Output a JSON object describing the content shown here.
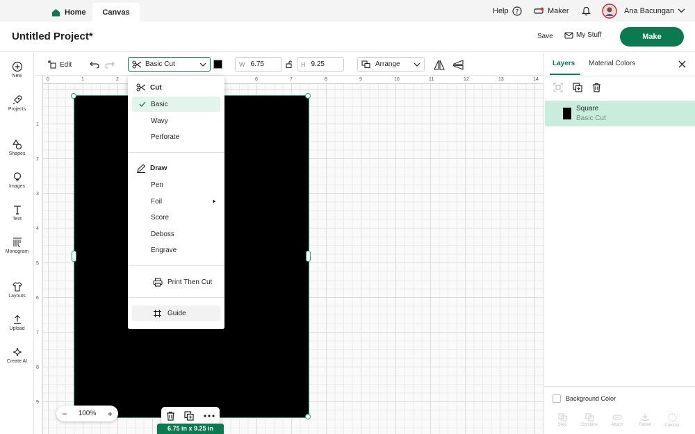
{
  "nav": {
    "home_label": "Home",
    "canvas_label": "Canvas",
    "help_label": "Help",
    "machine_label": "Maker",
    "user_name": "Ana Bacungan"
  },
  "header": {
    "project_title": "Untitled Project*",
    "save_label": "Save",
    "mystuff_label": "My Stuff",
    "make_label": "Make"
  },
  "sidebar": {
    "items": [
      {
        "label": "New",
        "icon": "plus-circle-icon"
      },
      {
        "label": "Projects",
        "icon": "rocket-icon"
      },
      {
        "label": "Shapes",
        "icon": "shapes-icon"
      },
      {
        "label": "Images",
        "icon": "lightbulb-icon"
      },
      {
        "label": "Text",
        "icon": "text-icon"
      },
      {
        "label": "Monogram",
        "icon": "monogram-icon"
      },
      {
        "label": "Layouts",
        "icon": "shirt-icon"
      },
      {
        "label": "Upload",
        "icon": "upload-icon"
      },
      {
        "label": "Create AI",
        "icon": "sparkle-icon"
      }
    ]
  },
  "toolbar": {
    "edit_label": "Edit",
    "operation_value": "Basic Cut",
    "color_swatch": "#000000",
    "width_label": "W",
    "width_value": "6.75",
    "height_label": "H",
    "height_value": "9.25",
    "arrange_label": "Arrange"
  },
  "ruler": {
    "top_ticks": [
      "0",
      "1",
      "2",
      "3",
      "4",
      "5",
      "6",
      "7",
      "8",
      "9",
      "10",
      "11",
      "12",
      "13",
      "14"
    ],
    "left_ticks": [
      "1",
      "2",
      "3",
      "4",
      "5",
      "6",
      "7",
      "8",
      "9"
    ]
  },
  "canvas": {
    "zoom_label": "100%",
    "zoom_minus": "−",
    "zoom_plus": "+",
    "size_badge": "6.75 in x 9.25 in",
    "shape_color": "#000000"
  },
  "operation_menu": {
    "cut_heading": "Cut",
    "cut_items": [
      "Basic",
      "Wavy",
      "Perforate"
    ],
    "selected": "Basic",
    "draw_heading": "Draw",
    "draw_items": [
      "Pen",
      "Foil",
      "Score",
      "Deboss",
      "Engrave"
    ],
    "print_then_cut": "Print Then Cut",
    "guide": "Guide"
  },
  "right_panel": {
    "tab_layers": "Layers",
    "tab_material": "Material Colors",
    "layer": {
      "name": "Square",
      "operation": "Basic Cut"
    },
    "background_color_label": "Background Color",
    "bottom_actions": [
      "Slice",
      "Combine",
      "Attach",
      "Flatten",
      "Contour"
    ]
  },
  "colors": {
    "accent": "#0b7a50",
    "selected_row": "#c9eddd"
  }
}
